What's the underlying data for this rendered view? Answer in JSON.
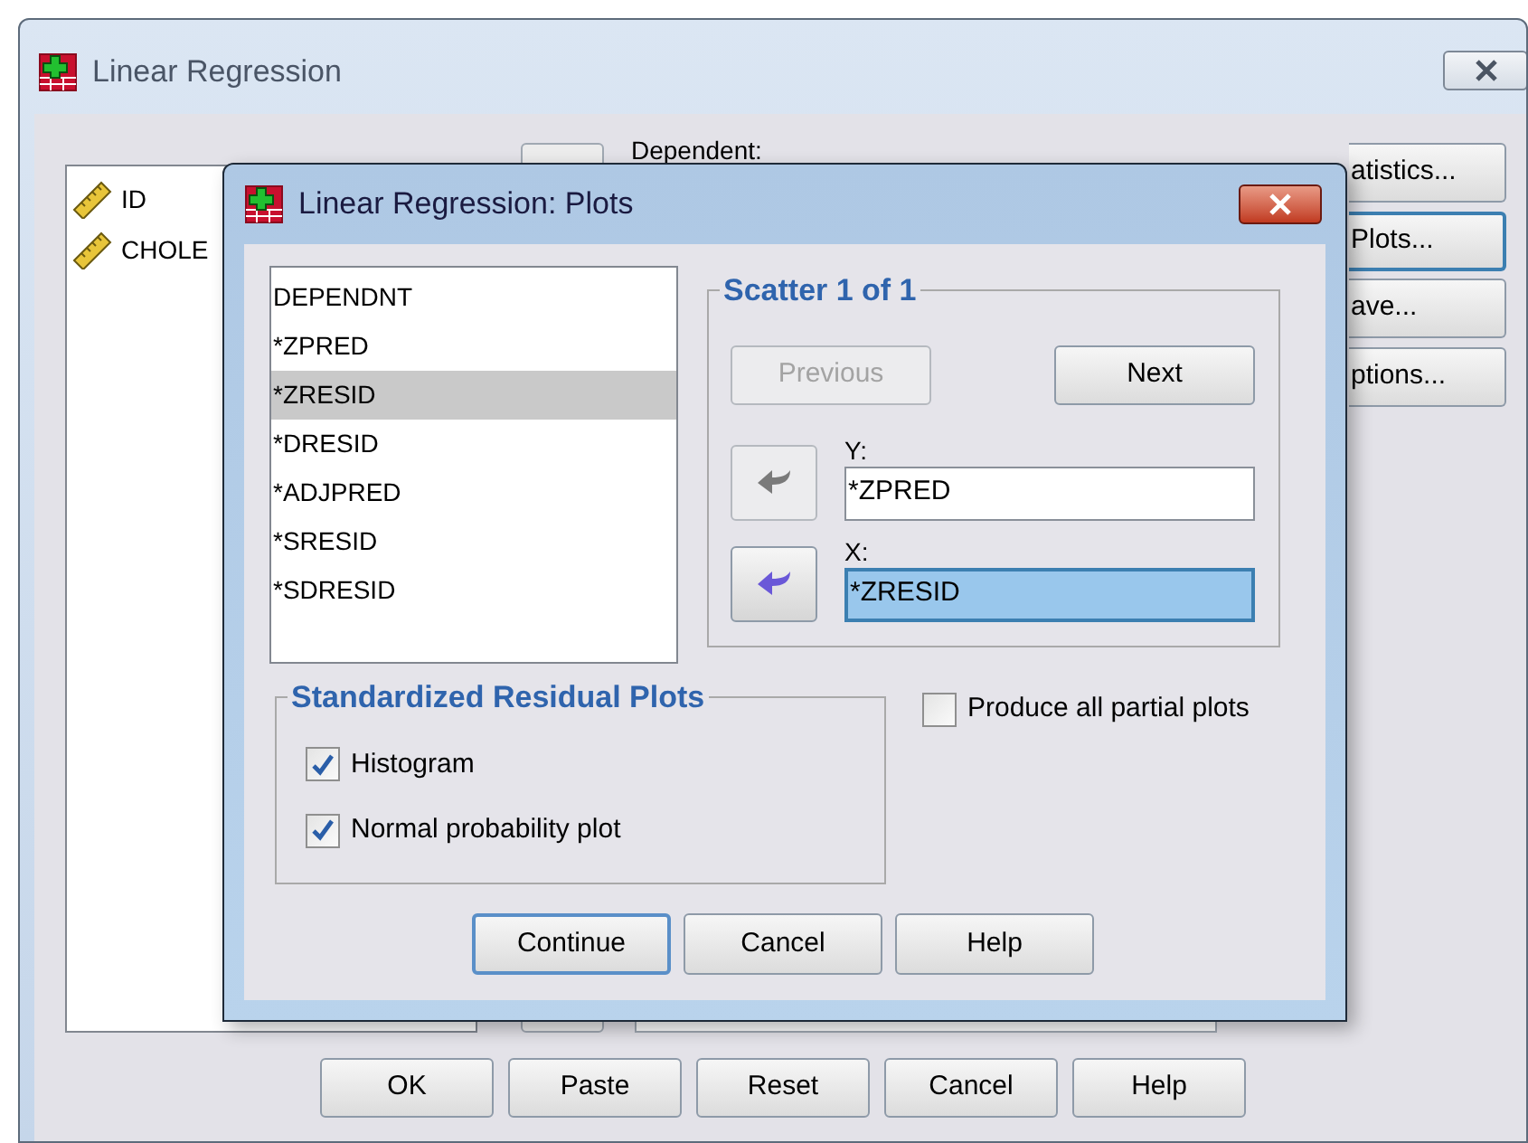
{
  "window": {
    "title": "Linear Regression"
  },
  "variables": [
    {
      "name": "ID"
    },
    {
      "name": "CHOLE"
    }
  ],
  "dependent_label": "Dependent:",
  "side_buttons": [
    {
      "label": "atistics...",
      "focused": false
    },
    {
      "label": "Plots...",
      "focused": true
    },
    {
      "label": "ave...",
      "focused": false
    },
    {
      "label": "ptions...",
      "focused": false
    }
  ],
  "bottom_buttons": [
    "OK",
    "Paste",
    "Reset",
    "Cancel",
    "Help"
  ],
  "dialog": {
    "title": "Linear Regression: Plots",
    "source_list": [
      {
        "label": "DEPENDNT",
        "selected": false
      },
      {
        "label": "*ZPRED",
        "selected": false
      },
      {
        "label": "*ZRESID",
        "selected": true
      },
      {
        "label": "*DRESID",
        "selected": false
      },
      {
        "label": "*ADJPRED",
        "selected": false
      },
      {
        "label": "*SRESID",
        "selected": false
      },
      {
        "label": "*SDRESID",
        "selected": false
      }
    ],
    "scatter": {
      "legend": "Scatter 1 of 1",
      "nav_buttons": [
        {
          "label": "Previous",
          "disabled": true
        },
        {
          "label": "Next",
          "disabled": false
        }
      ],
      "fields": [
        {
          "label": "Y:",
          "value": "*ZPRED",
          "selected": false
        },
        {
          "label": "X:",
          "value": "*ZRESID",
          "selected": true
        }
      ]
    },
    "residual_plots": {
      "legend": "Standardized Residual Plots",
      "options": [
        {
          "label": "Histogram",
          "checked": true
        },
        {
          "label": "Normal probability plot",
          "checked": true
        }
      ]
    },
    "partial_plots": {
      "label": "Produce all partial plots",
      "checked": false
    },
    "buttons": [
      {
        "label": "Continue",
        "default": true
      },
      {
        "label": "Cancel",
        "default": false
      },
      {
        "label": "Help",
        "default": false
      }
    ]
  }
}
